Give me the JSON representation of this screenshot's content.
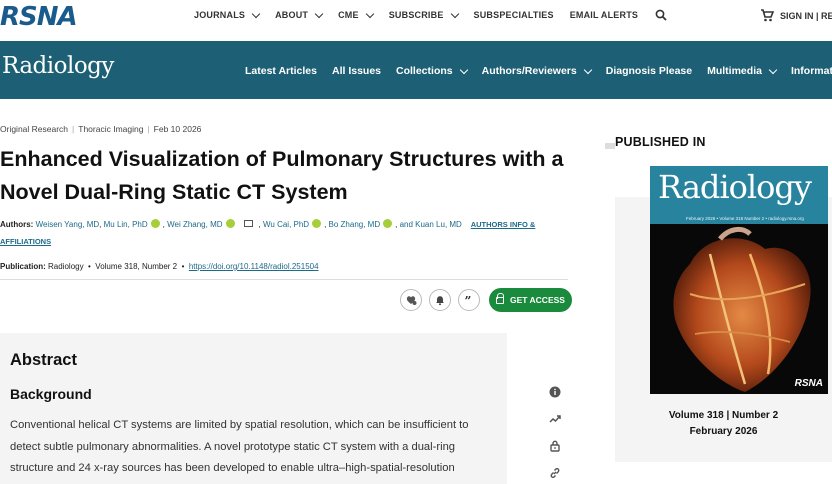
{
  "topbar": {
    "logo": "RSNA",
    "nav": [
      {
        "label": "JOURNALS",
        "dropdown": true
      },
      {
        "label": "ABOUT",
        "dropdown": true
      },
      {
        "label": "CME",
        "dropdown": true
      },
      {
        "label": "SUBSCRIBE",
        "dropdown": true
      },
      {
        "label": "SUBSPECIALTIES",
        "dropdown": false
      },
      {
        "label": "EMAIL ALERTS",
        "dropdown": false
      }
    ],
    "signin": "SIGN IN | REG"
  },
  "journal_nav": {
    "logo": "Radiology",
    "items": [
      {
        "label": "Latest Articles",
        "dropdown": false
      },
      {
        "label": "All Issues",
        "dropdown": false
      },
      {
        "label": "Collections",
        "dropdown": true
      },
      {
        "label": "Authors/Reviewers",
        "dropdown": true
      },
      {
        "label": "Diagnosis Please",
        "dropdown": false
      },
      {
        "label": "Multimedia",
        "dropdown": true
      },
      {
        "label": "Information",
        "dropdown": false
      }
    ]
  },
  "article": {
    "crumbs": [
      "Original Research",
      "Thoracic Imaging",
      "Feb 10 2026"
    ],
    "title": "Enhanced Visualization of Pulmonary Structures with a Novel Dual-Ring Static CT System",
    "authors_label": "Authors:",
    "authors": [
      "Weisen Yang, MD",
      "Mu Lin, PhD",
      "Wei Zhang, MD",
      "Wu Cai, PhD",
      "Bo Zhang, MD",
      "and Kuan Lu, MD"
    ],
    "authors_info_link": "AUTHORS INFO & AFFILIATIONS",
    "publication_label": "Publication:",
    "journal": "Radiology",
    "volume": "Volume 318, Number 2",
    "doi": "https://doi.org/10.1148/radiol.251504",
    "get_access": "GET ACCESS"
  },
  "abstract": {
    "heading": "Abstract",
    "background_heading": "Background",
    "background_text": "Conventional helical CT systems are limited by spatial resolution, which can be insufficient to detect subtle pulmonary abnormalities. A novel prototype static CT system with a dual-ring structure and 24 x-ray sources has been developed to enable ultra–high-spatial-resolution"
  },
  "sidebar": {
    "published_in": "PUBLISHED IN",
    "cover_title": "Radiology",
    "cover_strip": "February 2026 • Volume 318 Number 2 • radiology.rsna.org",
    "cover_publisher": "RSNA",
    "volume_line": "Volume 318 | Number 2",
    "date_line": "February 2026"
  },
  "colors": {
    "journal_bar": "#1d5f75",
    "link": "#1d6a8a",
    "access_button": "#1a8a3c",
    "rsna_blue": "#1a5b8c"
  },
  "icons": [
    "search-icon",
    "cart-icon",
    "citation-alert-icon",
    "bell-icon",
    "quote-icon",
    "lock-icon",
    "info-icon",
    "trend-icon",
    "link-icon",
    "orcid-icon",
    "mail-icon"
  ]
}
